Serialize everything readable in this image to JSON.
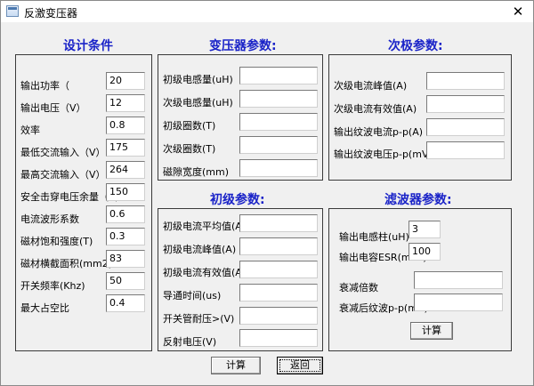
{
  "window": {
    "title": "反激变压器",
    "close": "✕"
  },
  "design": {
    "title": "设计条件",
    "fields": [
      {
        "label": "输出功率（",
        "value": "20"
      },
      {
        "label": "输出电压（V）",
        "value": "12"
      },
      {
        "label": "效率",
        "value": "0.8"
      },
      {
        "label": "最低交流输入（V）",
        "value": "175"
      },
      {
        "label": "最高交流输入（V）",
        "value": "264"
      },
      {
        "label": "安全击穿电压余量（V）",
        "value": "150"
      },
      {
        "label": "电流波形系数",
        "value": "0.6"
      },
      {
        "label": "磁材饱和强度(T)",
        "value": "0.3"
      },
      {
        "label": "磁材横截面积(mm2)",
        "value": "83"
      },
      {
        "label": "开关频率(Khz)",
        "value": "50"
      },
      {
        "label": "最大占空比",
        "value": "0.4"
      }
    ]
  },
  "transformer": {
    "title": "变压器参数:",
    "fields": [
      {
        "label": "初级电感量(uH)",
        "value": ""
      },
      {
        "label": "次级电感量(uH)",
        "value": ""
      },
      {
        "label": "初级圈数(T)",
        "value": ""
      },
      {
        "label": "次级圈数(T)",
        "value": ""
      },
      {
        "label": "磁隙宽度(mm)",
        "value": ""
      }
    ]
  },
  "primary": {
    "title": "初级参数:",
    "fields": [
      {
        "label": "初级电流平均值(A)",
        "value": ""
      },
      {
        "label": "初级电流峰值(A)",
        "value": ""
      },
      {
        "label": "初级电流有效值(A)",
        "value": ""
      },
      {
        "label": "导通时间(us)",
        "value": ""
      },
      {
        "label": "开关管耐压>(V)",
        "value": ""
      },
      {
        "label": "反射电压(V)",
        "value": ""
      }
    ]
  },
  "secondary": {
    "title": "次极参数:",
    "fields": [
      {
        "label": "次级电流峰值(A)",
        "value": ""
      },
      {
        "label": "次级电流有效值(A)",
        "value": ""
      },
      {
        "label": "输出纹波电流p-p(A)",
        "value": ""
      },
      {
        "label": "输出纹波电压p-p(mV)",
        "value": ""
      }
    ]
  },
  "filter": {
    "title": "滤波器参数:",
    "fields": [
      {
        "label": "输出电感柱(uH)",
        "value": "3"
      },
      {
        "label": "输出电容ESR(moh)",
        "value": "100"
      },
      {
        "label": "衰减倍数",
        "value": ""
      },
      {
        "label": "衰减后纹波p-p(mV)",
        "value": ""
      }
    ],
    "calc_label": "计算"
  },
  "buttons": {
    "calc_label": "计算",
    "back_label": "返回"
  }
}
